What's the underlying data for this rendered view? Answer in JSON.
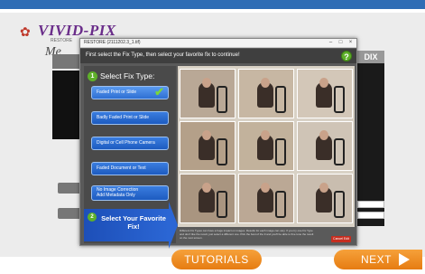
{
  "app": {
    "logo_text": "VIVID-PIX",
    "logo_subtext": "RESTORE",
    "logo_me": "Me",
    "background_panel_label": "DIX"
  },
  "dialog": {
    "title": "RESTORE (2111202.3_1.tif)",
    "instruction": "First select the Fix Type, then select your favorite fix to continue!",
    "help_icon": "?",
    "step1": {
      "number": "1",
      "label": "Select Fix Type:"
    },
    "fix_types": [
      {
        "label": "Faded Print or Slide",
        "selected": true
      },
      {
        "label": "Badly Faded Print or Slide",
        "selected": false
      },
      {
        "label": "Digital or Cell Phone Camera",
        "selected": false
      },
      {
        "label": "Faded Document or Text",
        "selected": false
      },
      {
        "label_line1": "No Image Correction",
        "label_line2": "Add Metadata Only",
        "selected": false
      }
    ],
    "step2": {
      "number": "2",
      "label": "Select Your Favorite Fix!"
    },
    "info_text": "Different Fix Types can have a huge impact on images. Results for each image can vary. If you try one Fix Type and don't like the result, just select a different one. Pick the best of the 9 and you'll be able to fine tune the result on the next screen.",
    "cancel_label": "Cancel Edit"
  },
  "thumbnails": [
    {
      "tint": "#b9a896"
    },
    {
      "tint": "#c7b7a3"
    },
    {
      "tint": "#d3c7b8"
    },
    {
      "tint": "#b4a089"
    },
    {
      "tint": "#c2b29c"
    },
    {
      "tint": "#cfc4b6"
    },
    {
      "tint": "#a99580"
    },
    {
      "tint": "#bba895"
    },
    {
      "tint": "#c9bdaf"
    }
  ],
  "footer": {
    "tutorials_label": "TUTORIALS",
    "next_label": "NEXT"
  },
  "colors": {
    "accent_orange": "#e67c12",
    "button_blue": "#2e6fd3",
    "success_green": "#5fb02a",
    "cancel_red": "#c62d1f",
    "top_bar_blue": "#2f6db5"
  }
}
